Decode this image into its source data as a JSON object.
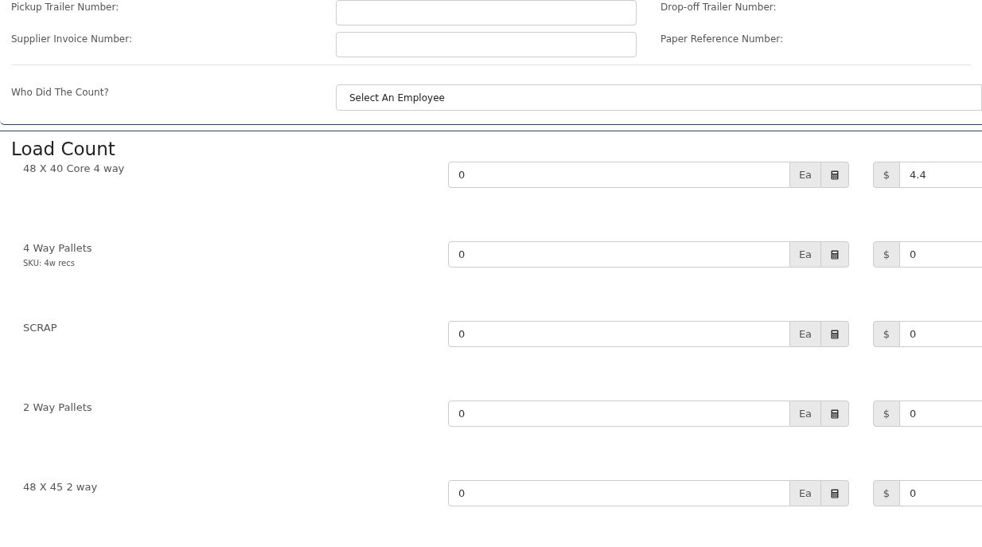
{
  "reference_fields": [
    {
      "left_label": "Pickup Trailer Number:",
      "right_label": "Drop-off Trailer Number:"
    },
    {
      "left_label": "Supplier Invoice Number:",
      "right_label": "Paper Reference Number:"
    }
  ],
  "counter": {
    "label": "Who Did The Count?",
    "value": "Select An Employee"
  },
  "load_count": {
    "title": "Load Count",
    "items": [
      {
        "name": "48 X 40 Core 4 way",
        "quantity": "0",
        "unit": "Ea",
        "currency": "$",
        "price": "4.4"
      },
      {
        "name": "4 Way Pallets",
        "sku": "SKU: 4w recs",
        "quantity": "0",
        "unit": "Ea",
        "currency": "$",
        "price": "0"
      },
      {
        "name": "SCRAP",
        "quantity": "0",
        "unit": "Ea",
        "currency": "$",
        "price": "0"
      },
      {
        "name": "2 Way Pallets",
        "quantity": "0",
        "unit": "Ea",
        "currency": "$",
        "price": "0"
      },
      {
        "name": "48 X 45 2 way",
        "quantity": "0",
        "unit": "Ea",
        "currency": "$",
        "price": "0"
      }
    ]
  }
}
